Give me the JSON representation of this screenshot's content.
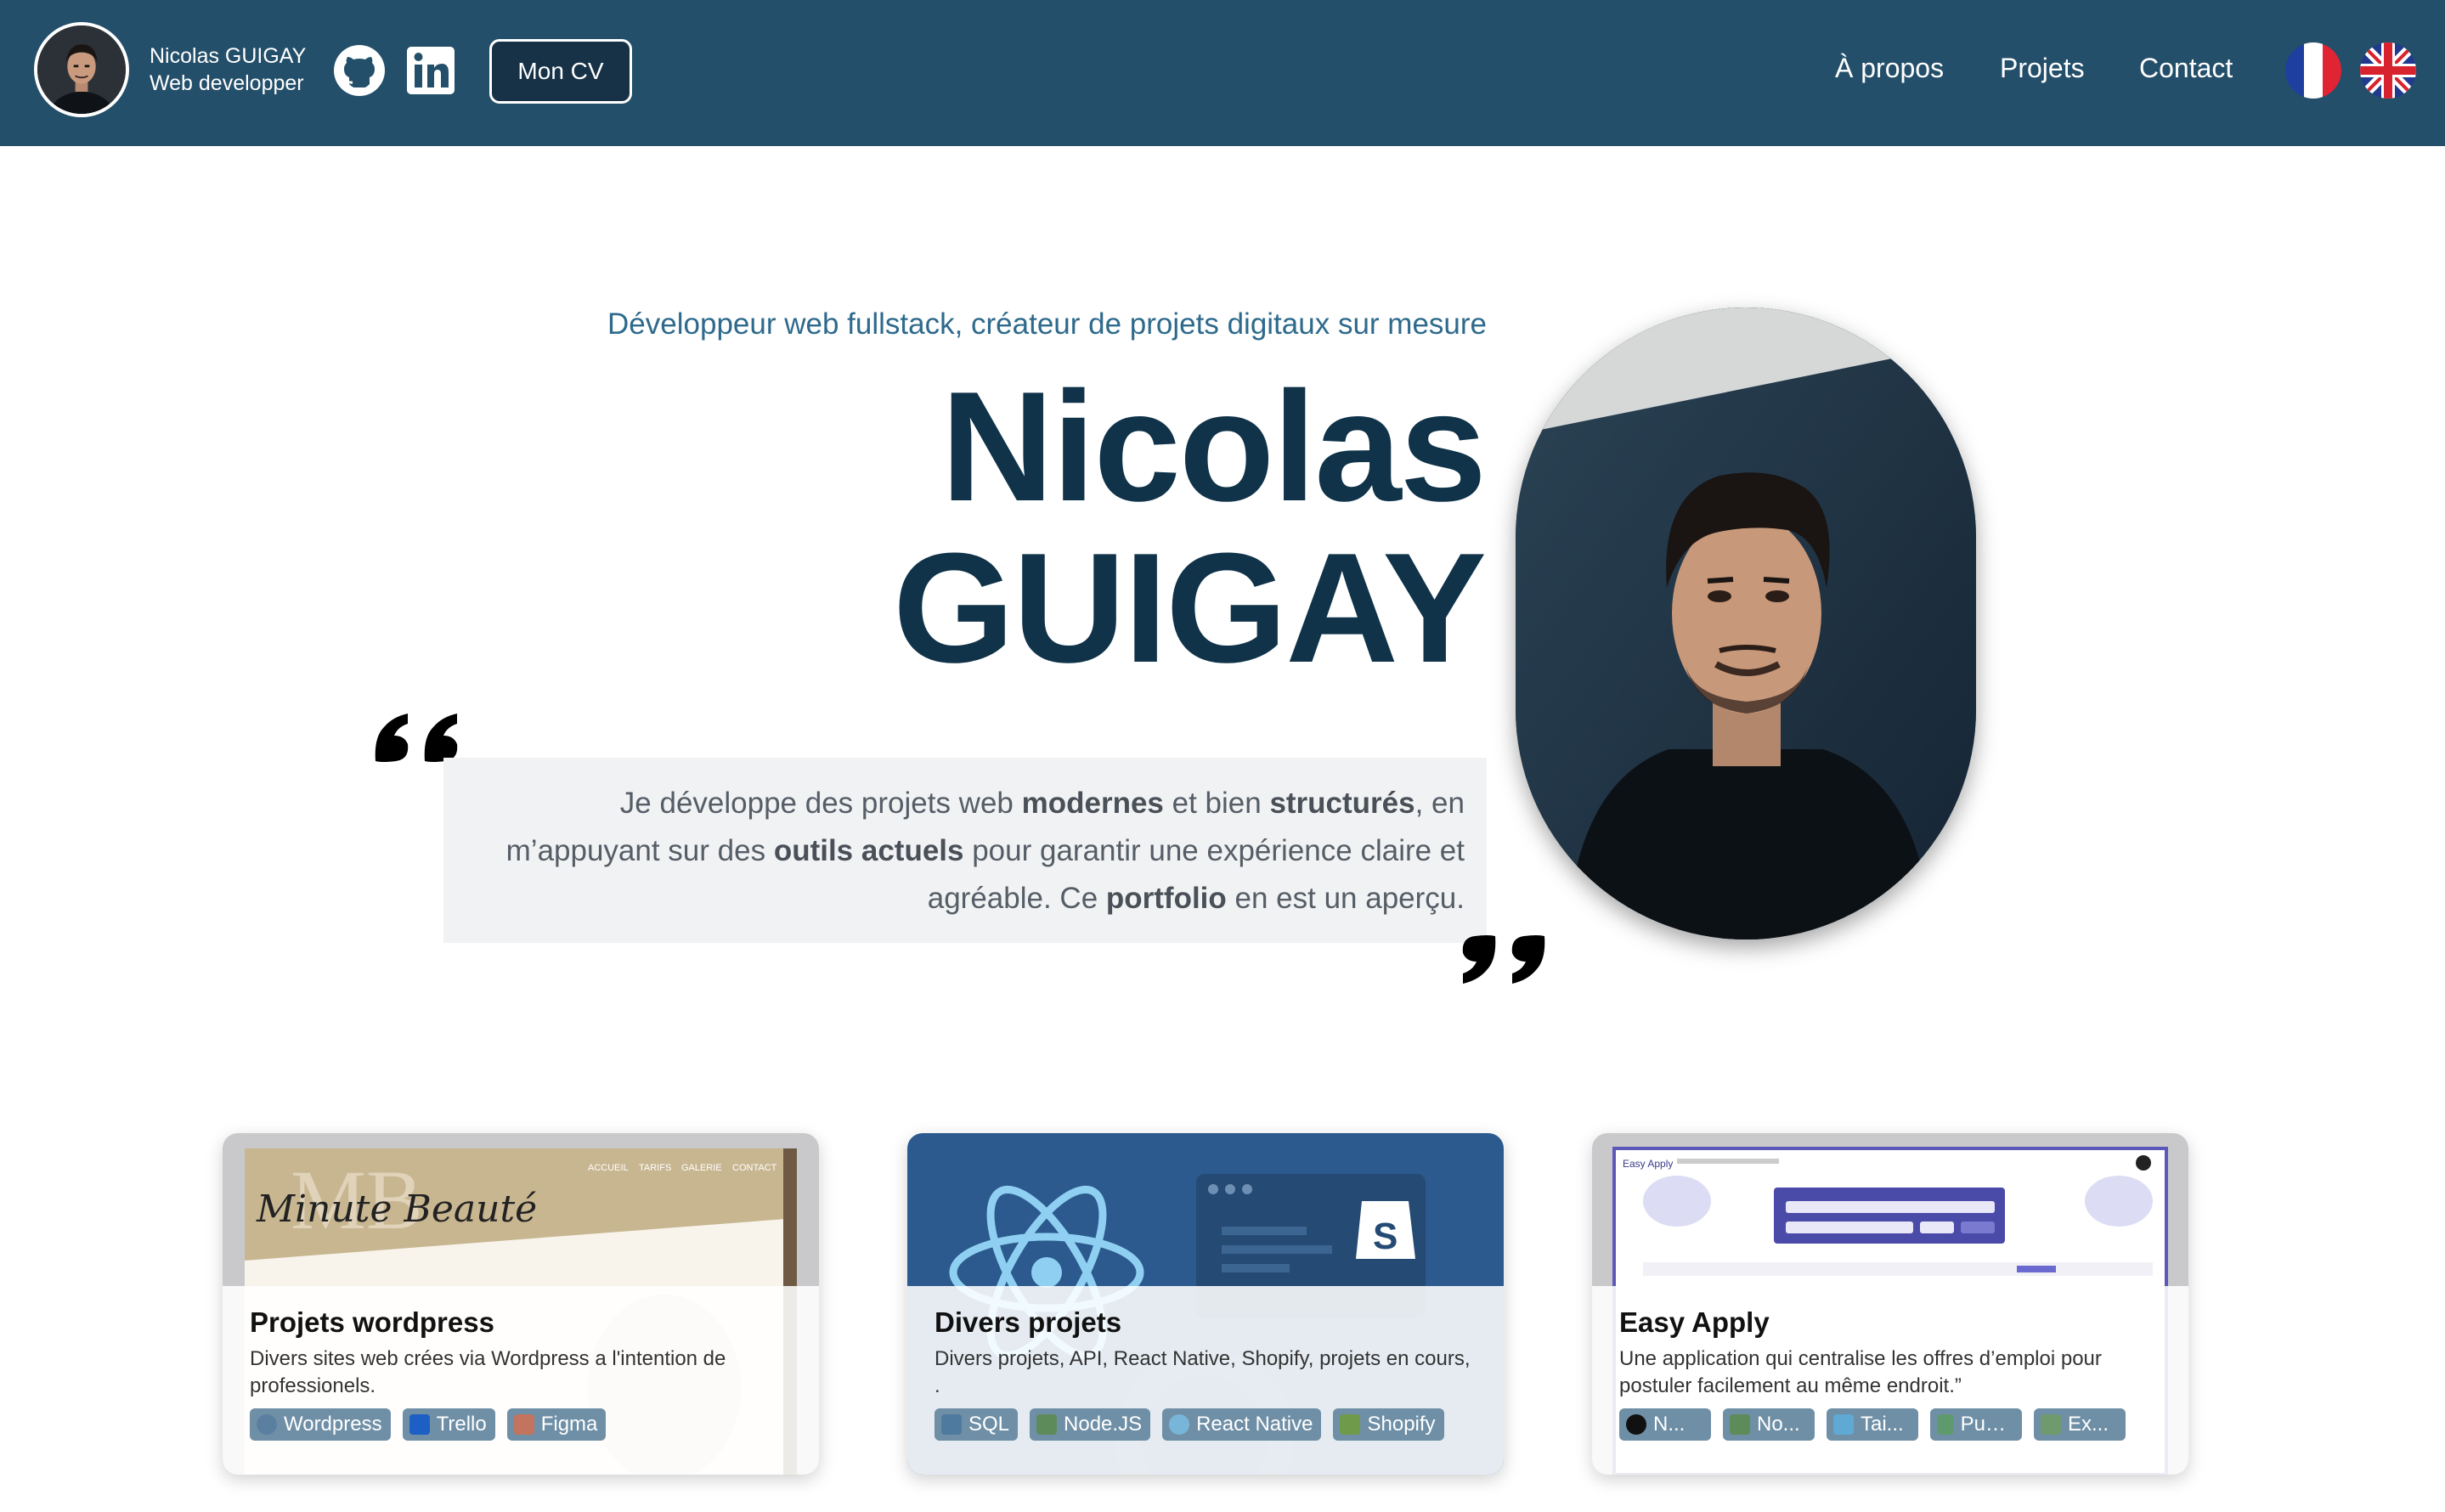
{
  "header": {
    "brand_name": "Nicolas GUIGAY",
    "brand_role": "Web developper",
    "cv_label": "Mon CV",
    "nav": [
      "À propos",
      "Projets",
      "Contact"
    ],
    "icons": [
      "github-icon",
      "linkedin-icon"
    ],
    "languages": [
      "french-flag",
      "uk-flag"
    ],
    "bg_color": "#244f6a"
  },
  "hero": {
    "subtitle": "Développeur web fullstack, créateur de projets digitaux sur mesure",
    "name_line1": "Nicolas",
    "name_line2": "GUIGAY",
    "quote": {
      "p1": "Je développe des projets web ",
      "b1": "modernes",
      "p2": " et bien ",
      "b2": "structurés",
      "p3": ", en m’appuyant sur des ",
      "b3": "outils actuels",
      "p4": " pour garantir une expérience claire et agréable. Ce ",
      "b4": "portfolio",
      "p5": " en est un aperçu."
    },
    "name_color": "#10334a"
  },
  "cards": [
    {
      "title": "Projets wordpress",
      "description": "Divers sites web crées via Wordpress a l'intention de professionels.",
      "thumb_logo_text": "Minute Beauté",
      "thumb_menu": [
        "ACCUEIL",
        "TARIFS",
        "GALERIE",
        "CONTACT"
      ],
      "tags": [
        "Wordpress",
        "Trello",
        "Figma"
      ]
    },
    {
      "title": "Divers projets",
      "description": "Divers projets, API, React Native, Shopify, projets en cours, .",
      "tags": [
        "SQL",
        "Node.JS",
        "React Native",
        "Shopify"
      ]
    },
    {
      "title": "Easy Apply",
      "description": "Une application qui centralise les offres d’emploi pour postuler facilement au même endroit.”",
      "thumb_app_name": "Easy Apply",
      "tags": [
        "N...",
        "No...",
        "Tai...",
        "Pupp...",
        "Ex..."
      ]
    }
  ]
}
